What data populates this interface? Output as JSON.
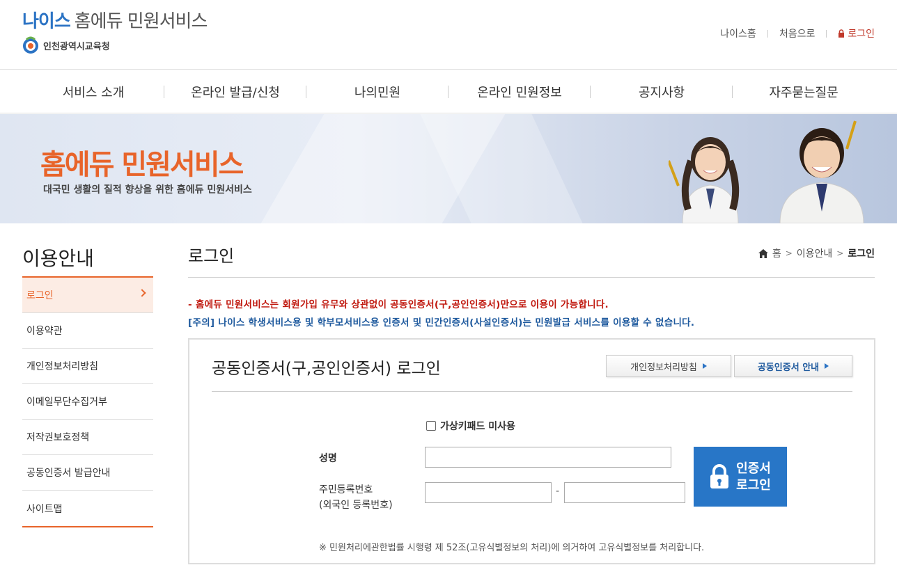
{
  "header": {
    "logo_neis": "나이스",
    "logo_rest": "홈에듀 민원서비스",
    "office_name": "인천광역시교육청",
    "links": [
      "나이스홈",
      "처음으로"
    ],
    "login_label": "로그인"
  },
  "gnb": [
    "서비스 소개",
    "온라인 발급/신청",
    "나의민원",
    "온라인 민원정보",
    "공지사항",
    "자주묻는질문"
  ],
  "banner": {
    "title": "홈에듀 민원서비스",
    "subtitle": "대국민 생활의 질적 향상을 위한 홈에듀 민원서비스"
  },
  "sidebar": {
    "title": "이용안내",
    "items": [
      "로그인",
      "이용약관",
      "개인정보처리방침",
      "이메일무단수집거부",
      "저작권보호정책",
      "공동인증서 발급안내",
      "사이트맵"
    ],
    "active_index": 0
  },
  "content": {
    "title": "로그인",
    "breadcrumb": {
      "home": "홈",
      "mid": "이용안내",
      "current": "로그인"
    },
    "notice1": "- 홈에듀 민원서비스는 회원가입 유무와 상관없이 공동인증서(구,공인인증서)만으로 이용이 가능합니다.",
    "notice2": "[주의] 나이스 학생서비스용 및 학부모서비스용 인증서 및 민간인증서(사설인증서)는 민원발급 서비스를 이용할 수 없습니다."
  },
  "login_box": {
    "title": "공동인증서(구,공인인증서) 로그인",
    "btn_privacy": "개인정보처리방침",
    "btn_cert_guide": "공동인증서 안내",
    "virtual_keypad_label": "가상키패드 미사용",
    "virtual_keypad_checked": false,
    "name_label": "성명",
    "name_value": "",
    "rrn_label_line1": "주민등록번호",
    "rrn_label_line2": "(외국인 등록번호)",
    "rrn_value_1": "",
    "rrn_value_2": "",
    "rrn_separator": "-",
    "cert_login_line1": "인증서",
    "cert_login_line2": "로그인",
    "footnote": "※ 민원처리에관한법률 시행령 제 52조(고유식별정보의 처리)에 의거하여 고유식별정보를 처리합니다."
  },
  "colors": {
    "accent": "#e8642a",
    "brand_blue": "#2876c7",
    "notice_red": "#c0180e",
    "notice_blue": "#1f5a9e"
  }
}
